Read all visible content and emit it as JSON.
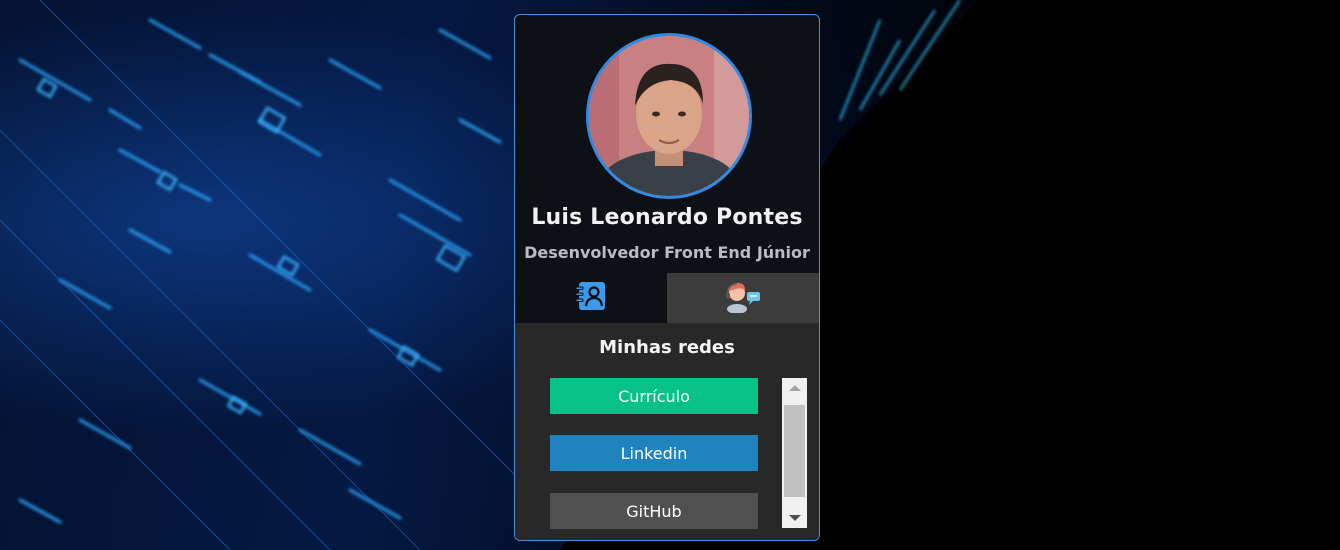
{
  "profile": {
    "name": "Luis Leonardo Pontes",
    "role": "Desenvolvedor Front End Júnior"
  },
  "tabs": [
    {
      "icon": "contact-book-icon",
      "active": true
    },
    {
      "icon": "support-agent-icon",
      "active": false
    }
  ],
  "panel": {
    "title": "Minhas redes",
    "links": [
      {
        "label": "Currículo",
        "color": "#06c286"
      },
      {
        "label": "Linkedin",
        "color": "#1e83bf"
      },
      {
        "label": "GitHub",
        "color": "#505050"
      }
    ]
  },
  "colors": {
    "accent": "#2f8be6",
    "card_bg": "#0d1014",
    "panel_bg": "#282828"
  }
}
